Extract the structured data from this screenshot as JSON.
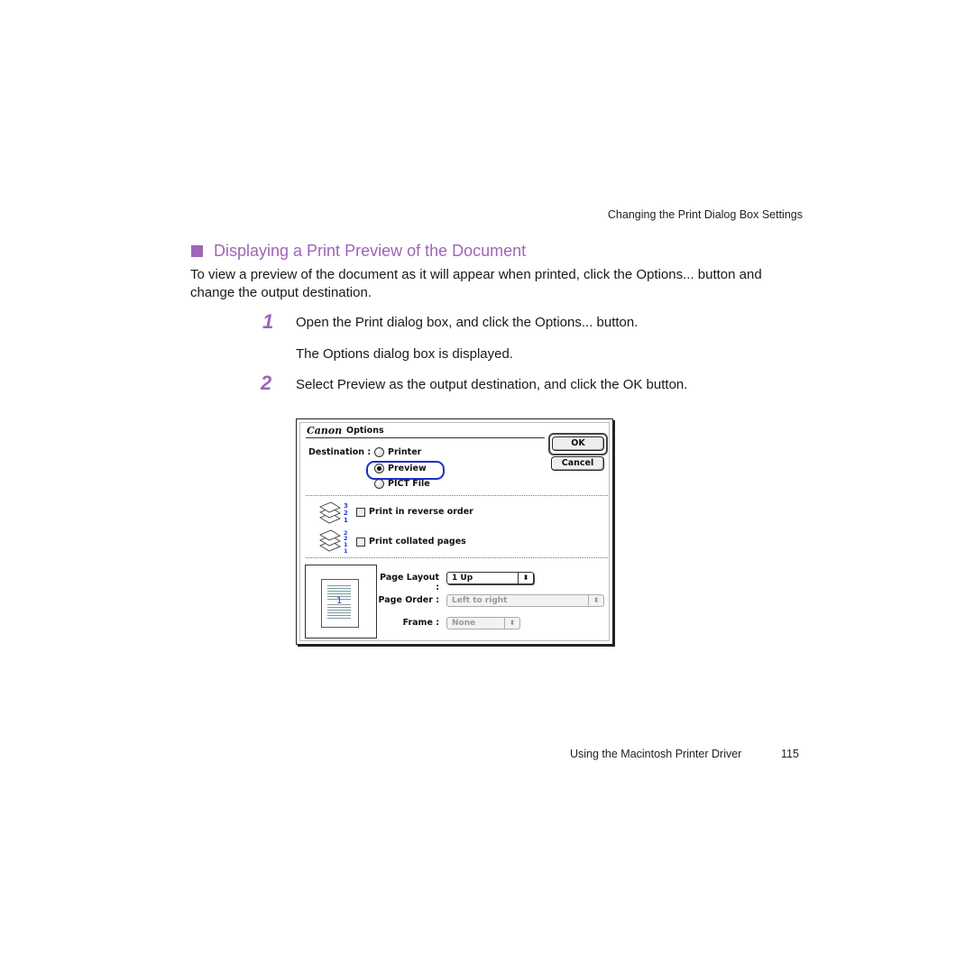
{
  "running_head": "Changing the Print Dialog Box Settings",
  "section": {
    "heading": "Displaying a Print Preview of the Document",
    "intro": "To view a preview of the document as it will appear when printed, click the Options... button and change the output destination."
  },
  "steps": [
    {
      "number": "1",
      "text": "Open the Print dialog box, and click the Options... button.",
      "result": "The Options dialog box is displayed."
    },
    {
      "number": "2",
      "text": "Select Preview as the output destination, and click the OK button."
    }
  ],
  "dialog": {
    "brand": "Canon",
    "title": "Options",
    "ok_label": "OK",
    "cancel_label": "Cancel",
    "destination_label": "Destination :",
    "destinations": [
      {
        "label": "Printer",
        "selected": false
      },
      {
        "label": "Preview",
        "selected": true
      },
      {
        "label": "PICT File",
        "selected": false
      }
    ],
    "reverse_order": {
      "label": "Print in reverse order",
      "checked": false,
      "icon_numbers": [
        "3",
        "2",
        "1"
      ]
    },
    "collated": {
      "label": "Print collated pages",
      "checked": false,
      "icon_numbers": [
        "2",
        "2",
        "1",
        "1"
      ]
    },
    "preview_page_number": "1",
    "page_layout": {
      "label": "Page Layout :",
      "value": "1 Up",
      "enabled": true
    },
    "page_order": {
      "label": "Page Order :",
      "value": "Left to right",
      "enabled": false
    },
    "frame": {
      "label": "Frame :",
      "value": "None",
      "enabled": false
    },
    "highlight_color": "#1c2ec8"
  },
  "footer": {
    "chapter": "Using the Macintosh Printer Driver",
    "page_number": "115"
  },
  "accent_color": "#a064b8"
}
